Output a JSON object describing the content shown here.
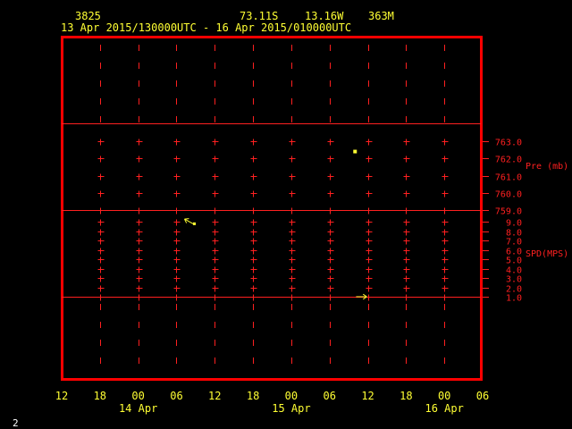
{
  "header": {
    "station_id": "3825",
    "lat": "73.11S",
    "lon": "13.16W",
    "elevation": "363M",
    "time_range": "13 Apr 2015/130000UTC - 16 Apr 2015/010000UTC"
  },
  "footer": {
    "page_number": "2"
  },
  "colors": {
    "background": "#000000",
    "frame": "#ff0000",
    "grid": "#ff2020",
    "data": "#ffff33",
    "text": "#ffff33"
  },
  "chart_data": {
    "type": "scatter",
    "x_ticks": [
      "12",
      "18",
      "00",
      "06",
      "12",
      "18",
      "00",
      "06",
      "12",
      "18",
      "00",
      "06"
    ],
    "date_labels": [
      {
        "label": "14 Apr",
        "tick_index": 2
      },
      {
        "label": "15 Apr",
        "tick_index": 6
      },
      {
        "label": "16 Apr",
        "tick_index": 10
      }
    ],
    "xlim_hours": [
      12,
      78
    ],
    "pressure_panel": {
      "label": "Pre (mb)",
      "ticks": [
        "763.0",
        "762.0",
        "761.0",
        "760.0",
        "759.0"
      ],
      "ylim": [
        759.0,
        763.0
      ],
      "points": [
        {
          "hour": 58,
          "value": 762.4
        }
      ]
    },
    "wind_panel": {
      "label": "SPD(MPS)",
      "ticks": [
        "9.0",
        "8.0",
        "7.0",
        "6.0",
        "5.0",
        "4.0",
        "3.0",
        "2.0",
        "1.0"
      ],
      "ylim": [
        1.0,
        9.0
      ],
      "barbs": [
        {
          "hour": 32,
          "speed": 9.0,
          "direction": "northwest"
        },
        {
          "hour": 59,
          "speed": 1.0,
          "direction": "east"
        }
      ]
    }
  }
}
